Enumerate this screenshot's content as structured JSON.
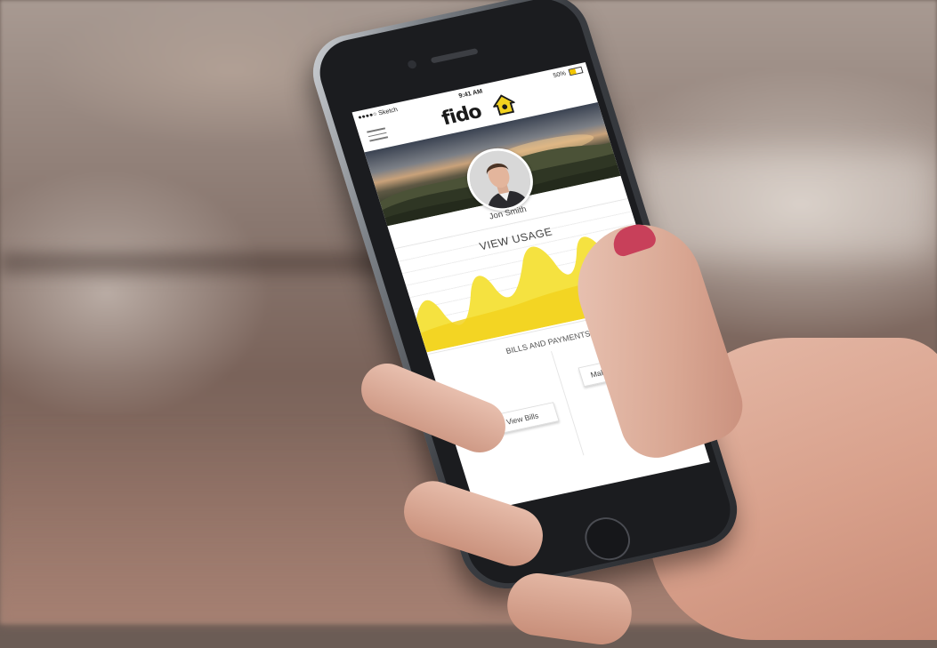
{
  "status_bar": {
    "carrier": "●●●●○ Sketch",
    "time": "9:41 AM",
    "battery": "50%",
    "battery_level": 0.5
  },
  "app": {
    "logo": "fido"
  },
  "profile": {
    "name": "Jon Smith"
  },
  "usage": {
    "title": "VIEW USAGE"
  },
  "bills": {
    "title": "BILLS AND PAYMENTS",
    "view_bills_label": "View Bills",
    "make_payments_label": "Make Payments"
  },
  "colors": {
    "accent": "#f5e240",
    "accent_dark": "#f2d21f",
    "nail": "#c8405a"
  },
  "icons": {
    "menu": "hamburger-menu-icon",
    "wifi": "wifi-icon",
    "battery": "battery-icon",
    "logo_house": "house-icon"
  }
}
